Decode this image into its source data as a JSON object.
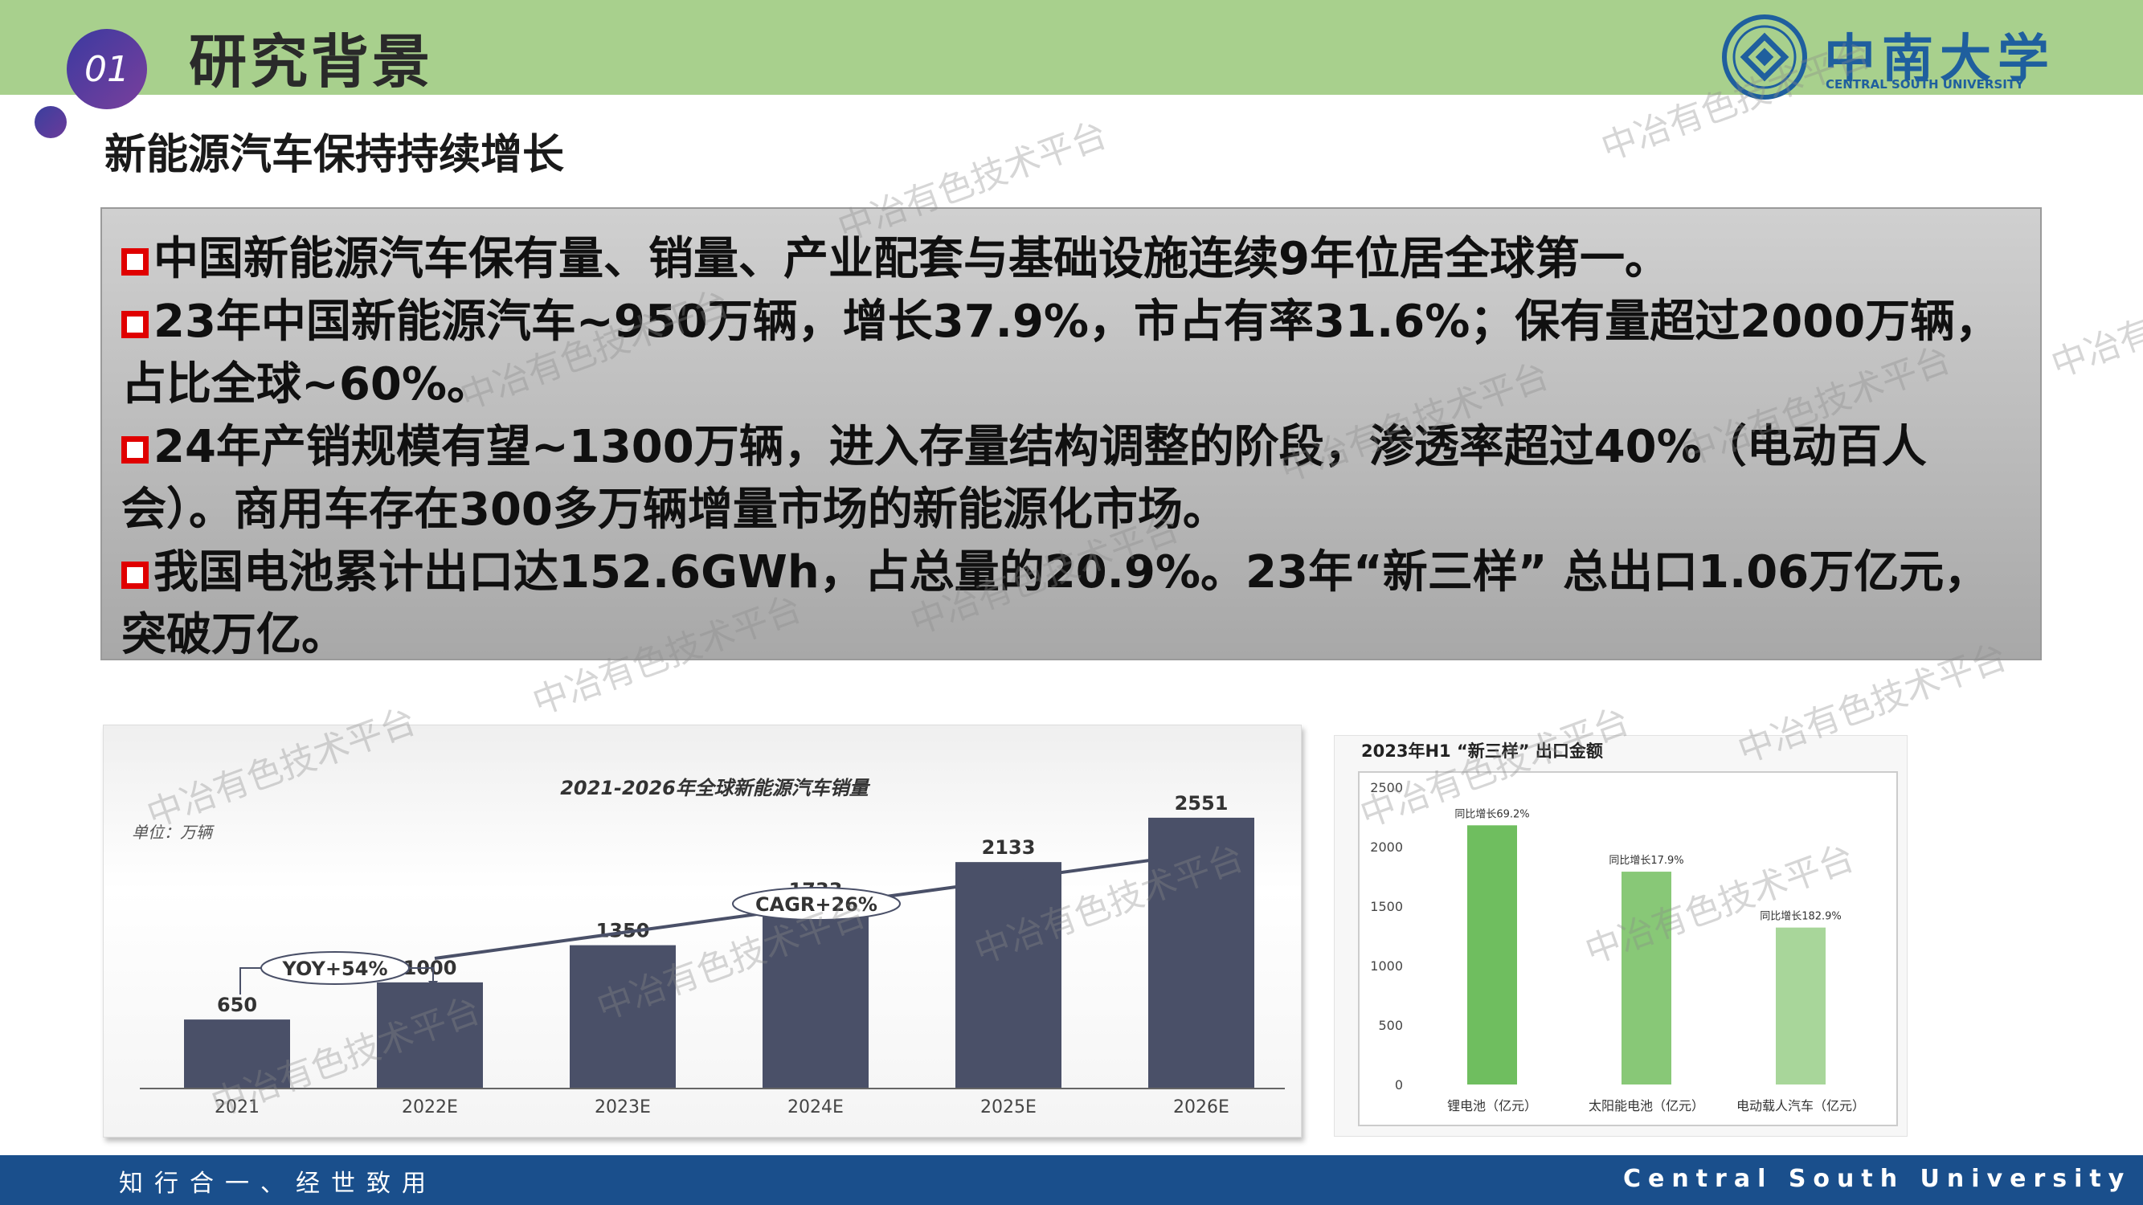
{
  "header": {
    "number": "01",
    "title": "研究背景",
    "logo_text": "中南大学",
    "logo_sub": "CENTRAL SOUTH UNIVERSITY"
  },
  "subtitle": "新能源汽车保持持续增长",
  "bullets": [
    "中国新能源汽车保有量、销量、产业配套与基础设施连续9年位居全球第一。",
    "23年中国新能源汽车~950万辆，增长37.9%，市占有率31.6%；保有量超过2000万辆，占比全球~60%。",
    "24年产销规模有望~1300万辆，进入存量结构调整的阶段，渗透率超过40%（电动百人会）。商用车存在300多万辆增量市场的新能源化市场。",
    "我国电池累计出口达152.6GWh，占总量的20.9%。23年“新三样” 总出口1.06万亿元，突破万亿。"
  ],
  "footer": {
    "motto": "知行合一、经世致用",
    "university": "Central South University"
  },
  "watermark": "中冶有色技术平台",
  "colors": {
    "header_green": "#a8d08d",
    "footer_blue": "#1a4f8c",
    "bar_dark": "#4a5068",
    "bar_green_1": "#6fbe5f",
    "bar_green_2": "#88c877",
    "bar_green_3": "#a8d69a",
    "bullet_red": "#e00000"
  },
  "chart_data": [
    {
      "type": "bar",
      "title": "2021-2026年全球新能源汽车销量",
      "unit": "单位：万辆",
      "categories": [
        "2021",
        "2022E",
        "2023E",
        "2024E",
        "2025E",
        "2026E"
      ],
      "values": [
        650,
        1000,
        1350,
        1733,
        2133,
        2551
      ],
      "annotations": [
        "YOY+54%",
        "CAGR+26%"
      ],
      "ylim": [
        0,
        2800
      ],
      "grid": false
    },
    {
      "type": "bar",
      "title": "2023年H1 “新三样” 出口金额",
      "categories": [
        "锂电池（亿元）",
        "太阳能电池（亿元）",
        "电动载人汽车（亿元）"
      ],
      "values": [
        2180,
        1790,
        1320
      ],
      "data_labels": [
        "同比增长69.2%",
        "同比增长17.9%",
        "同比增长182.9%"
      ],
      "y_ticks": [
        "0",
        "500",
        "1000",
        "1500",
        "2000",
        "2500"
      ],
      "ylim": [
        0,
        2500
      ],
      "grid": false
    }
  ]
}
